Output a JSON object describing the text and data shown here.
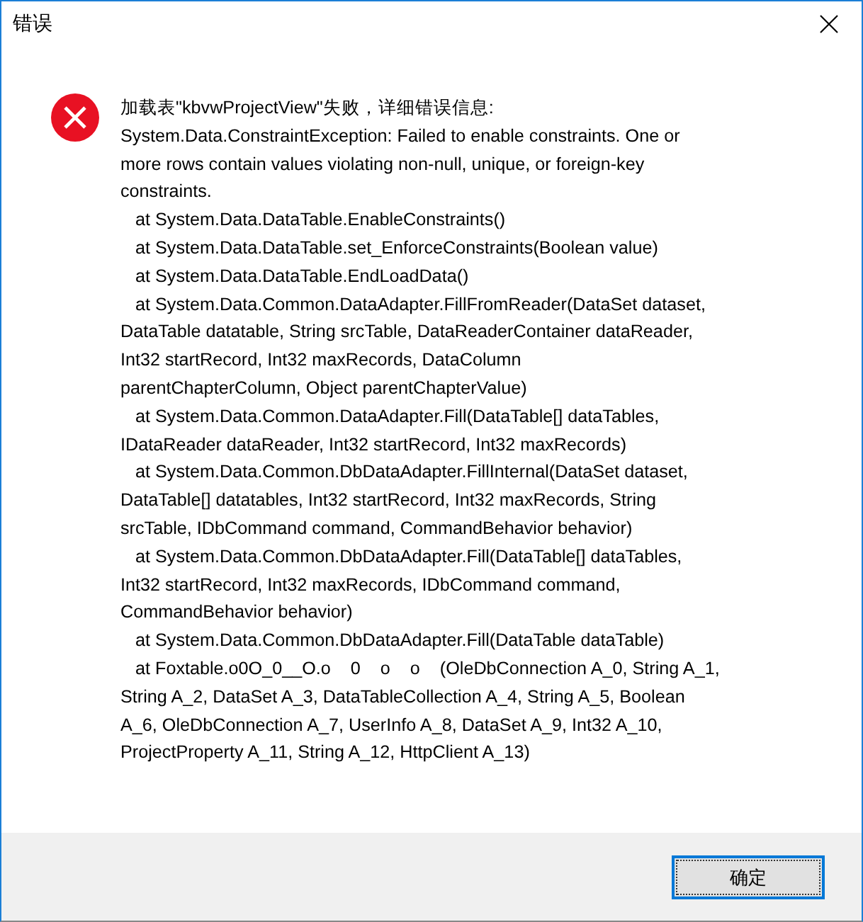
{
  "window": {
    "title": "错误"
  },
  "message": "加载表\"kbvwProjectView\"失败，详细错误信息:\nSystem.Data.ConstraintException: Failed to enable constraints. One or\nmore rows contain values violating non-null, unique, or foreign-key\nconstraints.\n   at System.Data.DataTable.EnableConstraints()\n   at System.Data.DataTable.set_EnforceConstraints(Boolean value)\n   at System.Data.DataTable.EndLoadData()\n   at System.Data.Common.DataAdapter.FillFromReader(DataSet dataset,\nDataTable datatable, String srcTable, DataReaderContainer dataReader,\nInt32 startRecord, Int32 maxRecords, DataColumn\nparentChapterColumn, Object parentChapterValue)\n   at System.Data.Common.DataAdapter.Fill(DataTable[] dataTables,\nIDataReader dataReader, Int32 startRecord, Int32 maxRecords)\n   at System.Data.Common.DbDataAdapter.FillInternal(DataSet dataset,\nDataTable[] datatables, Int32 startRecord, Int32 maxRecords, String\nsrcTable, IDbCommand command, CommandBehavior behavior)\n   at System.Data.Common.DbDataAdapter.Fill(DataTable[] dataTables,\nInt32 startRecord, Int32 maxRecords, IDbCommand command,\nCommandBehavior behavior)\n   at System.Data.Common.DbDataAdapter.Fill(DataTable dataTable)\n   at Foxtable.o0O_0__O.o    0    o    o    (OleDbConnection A_0, String A_1,\nString A_2, DataSet A_3, DataTableCollection A_4, String A_5, Boolean\nA_6, OleDbConnection A_7, UserInfo A_8, DataSet A_9, Int32 A_10,\nProjectProperty A_11, String A_12, HttpClient A_13)",
  "buttons": [
    "确定"
  ]
}
